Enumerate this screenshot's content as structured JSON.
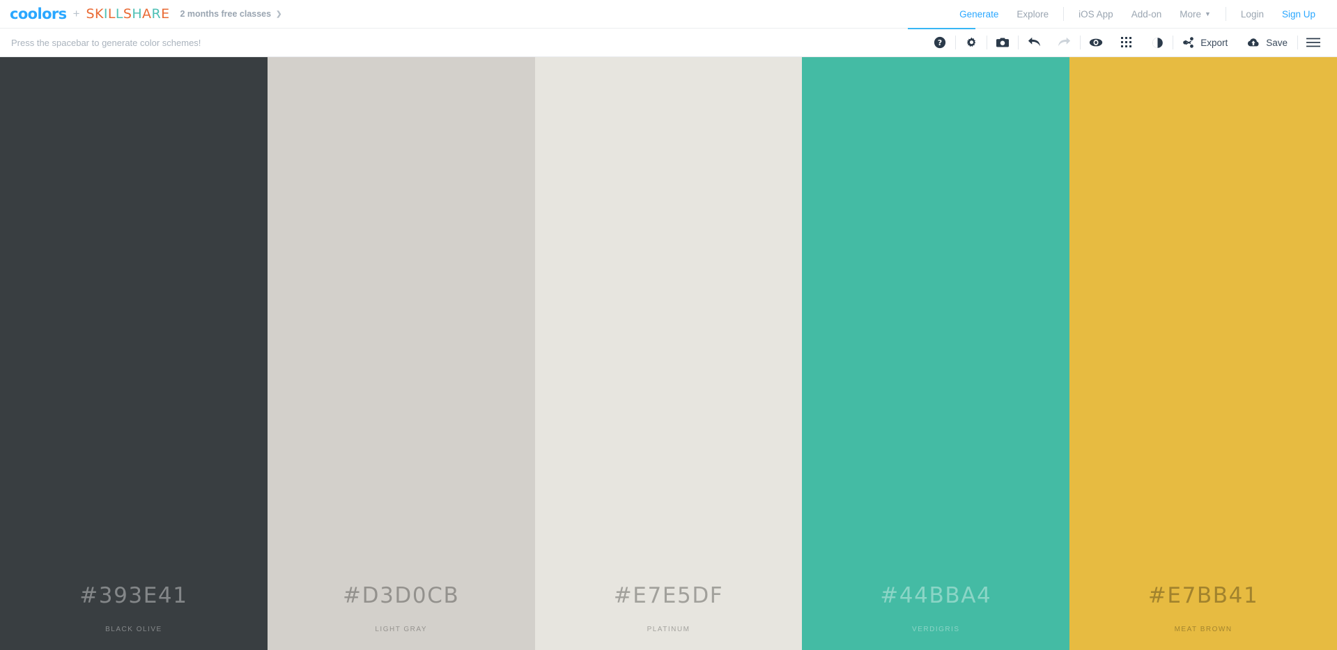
{
  "header": {
    "logo": "coolors",
    "plus": "+",
    "partner_logo": "SKILLSHARE",
    "partner_letters": [
      {
        "ch": "S",
        "color": "#e96a34"
      },
      {
        "ch": "K",
        "color": "#e96a34"
      },
      {
        "ch": "I",
        "color": "#4fc0b5"
      },
      {
        "ch": "L",
        "color": "#e96a34"
      },
      {
        "ch": "L",
        "color": "#4fc0b5"
      },
      {
        "ch": "S",
        "color": "#e96a34"
      },
      {
        "ch": "H",
        "color": "#4fc0b5"
      },
      {
        "ch": "A",
        "color": "#e96a34"
      },
      {
        "ch": "R",
        "color": "#4fc0b5"
      },
      {
        "ch": "E",
        "color": "#e96a34"
      }
    ],
    "promo": "2 months free classes",
    "promo_chevron": "❯",
    "nav": [
      {
        "label": "Generate",
        "state": "active"
      },
      {
        "label": "Explore",
        "state": "normal"
      },
      {
        "label": "iOS App",
        "state": "normal"
      },
      {
        "label": "Add-on",
        "state": "normal"
      },
      {
        "label": "More",
        "state": "normal",
        "caret": "▼"
      },
      {
        "label": "Login",
        "state": "normal"
      },
      {
        "label": "Sign Up",
        "state": "blue"
      }
    ],
    "accent_color": "#2aa7ff",
    "muted_color": "#9aa5b1"
  },
  "toolbar": {
    "hint": "Press the spacebar to generate color schemes!",
    "export_label": "Export",
    "save_label": "Save",
    "icons": [
      "help-icon",
      "gear-icon",
      "camera-icon",
      "undo-icon",
      "redo-icon",
      "eye-icon",
      "grid-icon",
      "contrast-icon",
      "share-icon",
      "cloud-upload-icon",
      "menu-icon"
    ]
  },
  "palette": {
    "swatches": [
      {
        "hex": "#393E41",
        "name": "Black Olive",
        "label": "BLACK OLIVE",
        "text": "light"
      },
      {
        "hex": "#D3D0CB",
        "name": "Light Gray",
        "label": "LIGHT GRAY",
        "text": "dark"
      },
      {
        "hex": "#E7E5DF",
        "name": "Platinum",
        "label": "PLATINUM",
        "text": "dark"
      },
      {
        "hex": "#44BBA4",
        "name": "Verdigris",
        "label": "VERDIGRIS",
        "text": "light"
      },
      {
        "hex": "#E7BB41",
        "name": "Meat Brown",
        "label": "MEAT BROWN",
        "text": "dark"
      }
    ]
  }
}
